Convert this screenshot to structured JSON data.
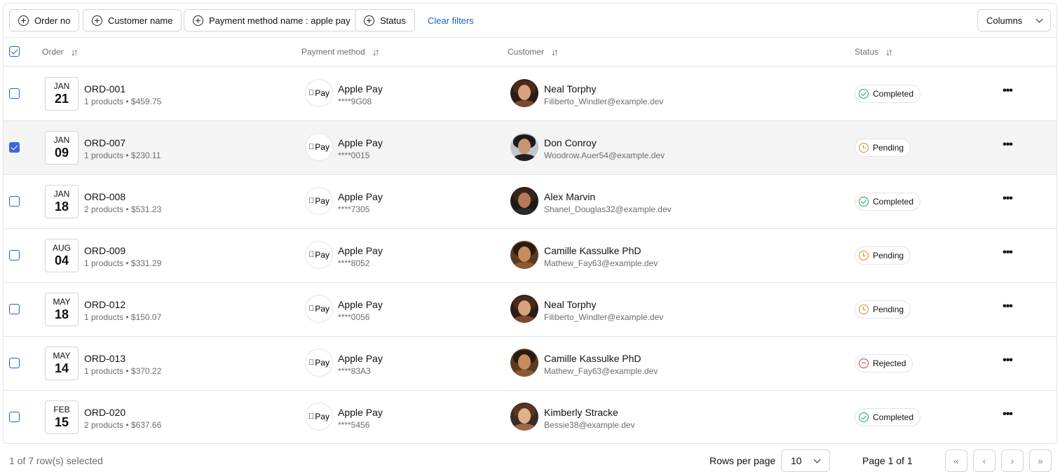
{
  "toolbar": {
    "filters": [
      "Order no",
      "Customer name",
      "Payment method name : apple pay",
      "Status"
    ],
    "clear_label": "Clear filters",
    "columns_label": "Columns"
  },
  "table": {
    "headers": {
      "order": "Order",
      "payment": "Payment method",
      "customer": "Customer",
      "status": "Status"
    },
    "rows": [
      {
        "month": "JAN",
        "day": "21",
        "order": "ORD-001",
        "summary": "1 products • $459.75",
        "pay_name": "Apple Pay",
        "pay_card": "****9G08",
        "customer": "Neal Torphy",
        "email": "Filiberto_Windler@example.dev",
        "status": "Completed",
        "status_kind": "ok",
        "selected": false
      },
      {
        "month": "JAN",
        "day": "09",
        "order": "ORD-007",
        "summary": "1 products • $230.11",
        "pay_name": "Apple Pay",
        "pay_card": "****0015",
        "customer": "Don Conroy",
        "email": "Woodrow.Auer54@example.dev",
        "status": "Pending",
        "status_kind": "pend",
        "selected": true
      },
      {
        "month": "JAN",
        "day": "18",
        "order": "ORD-008",
        "summary": "2 products • $531.23",
        "pay_name": "Apple Pay",
        "pay_card": "****7305",
        "customer": "Alex Marvin",
        "email": "Shanel_Douglas32@example.dev",
        "status": "Completed",
        "status_kind": "ok",
        "selected": false
      },
      {
        "month": "AUG",
        "day": "04",
        "order": "ORD-009",
        "summary": "1 products • $331.29",
        "pay_name": "Apple Pay",
        "pay_card": "****8052",
        "customer": "Camille Kassulke PhD",
        "email": "Mathew_Fay63@example.dev",
        "status": "Pending",
        "status_kind": "pend",
        "selected": false
      },
      {
        "month": "MAY",
        "day": "18",
        "order": "ORD-012",
        "summary": "1 products • $150.07",
        "pay_name": "Apple Pay",
        "pay_card": "****0056",
        "customer": "Neal Torphy",
        "email": "Filiberto_Windler@example.dev",
        "status": "Pending",
        "status_kind": "pend",
        "selected": false
      },
      {
        "month": "MAY",
        "day": "14",
        "order": "ORD-013",
        "summary": "1 products • $370.22",
        "pay_name": "Apple Pay",
        "pay_card": "****83A3",
        "customer": "Camille Kassulke PhD",
        "email": "Mathew_Fay63@example.dev",
        "status": "Rejected",
        "status_kind": "rej",
        "selected": false
      },
      {
        "month": "FEB",
        "day": "15",
        "order": "ORD-020",
        "summary": "2 products • $637.66",
        "pay_name": "Apple Pay",
        "pay_card": "****5456",
        "customer": "Kimberly Stracke",
        "email": "Bessie38@example.dev",
        "status": "Completed",
        "status_kind": "ok",
        "selected": false
      }
    ]
  },
  "pay_badge_label": "Pay",
  "footer": {
    "selection": "1 of 7 row(s) selected",
    "rows_per_page_label": "Rows per page",
    "rows_per_page_value": "10",
    "page_label": "Page 1 of 1"
  },
  "colors": {
    "accent": "#3866e0",
    "completed": "#22a45d",
    "pending": "#e0862b",
    "rejected": "#d93a3a"
  }
}
